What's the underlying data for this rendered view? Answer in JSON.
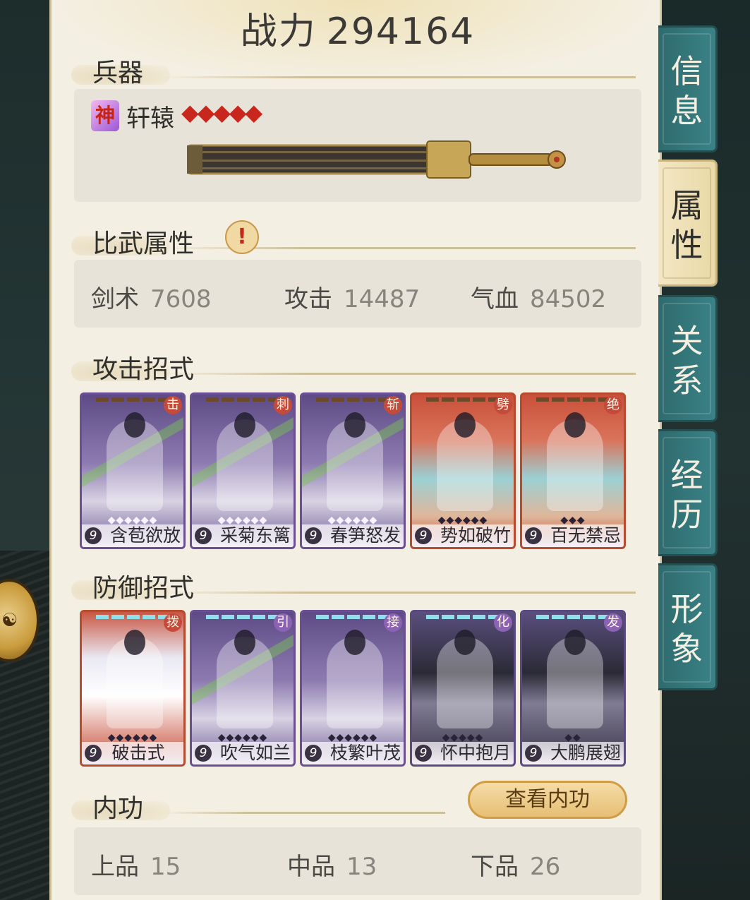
{
  "power": {
    "label": "战力",
    "value": "294164"
  },
  "sections": {
    "weapon": "兵器",
    "compare": "比武属性",
    "attack": "攻击招式",
    "defense": "防御招式",
    "inner": "内功"
  },
  "weapon": {
    "badge": "神",
    "name": "轩辕",
    "stars": "◆◆◆◆◆"
  },
  "compare_attrs": [
    {
      "label": "剑术",
      "value": "7608"
    },
    {
      "label": "攻击",
      "value": "14487"
    },
    {
      "label": "气血",
      "value": "84502"
    }
  ],
  "attack_moves": [
    {
      "tag": "击",
      "level": "9",
      "name": "含苞欲放",
      "stars": "◆◆◆◆◆◆"
    },
    {
      "tag": "刺",
      "level": "9",
      "name": "采菊东篱",
      "stars": "◆◆◆◆◆◆"
    },
    {
      "tag": "斩",
      "level": "9",
      "name": "春笋怒发",
      "stars": "◆◆◆◆◆◆"
    },
    {
      "tag": "劈",
      "level": "9",
      "name": "势如破竹",
      "stars": "◆◆◆◆◆◆"
    },
    {
      "tag": "绝",
      "level": "9",
      "name": "百无禁忌",
      "stars": "◆◆◆"
    }
  ],
  "defense_moves": [
    {
      "tag": "拨",
      "level": "9",
      "name": "破击式",
      "stars": "◆◆◆◆◆◆"
    },
    {
      "tag": "引",
      "level": "9",
      "name": "吹气如兰",
      "stars": "◆◆◆◆◆◆"
    },
    {
      "tag": "接",
      "level": "9",
      "name": "枝繁叶茂",
      "stars": "◆◆◆◆◆◆"
    },
    {
      "tag": "化",
      "level": "9",
      "name": "怀中抱月",
      "stars": "◆◆◆◆◆"
    },
    {
      "tag": "发",
      "level": "9",
      "name": "大鹏展翅",
      "stars": "◆◆"
    }
  ],
  "inner": {
    "button": "查看内功",
    "grades": [
      {
        "label": "上品",
        "value": "15"
      },
      {
        "label": "中品",
        "value": "13"
      },
      {
        "label": "下品",
        "value": "26"
      }
    ]
  },
  "tabs": [
    {
      "line1": "信",
      "line2": "息"
    },
    {
      "line1": "属",
      "line2": "性"
    },
    {
      "line1": "关",
      "line2": "系"
    },
    {
      "line1": "经",
      "line2": "历"
    },
    {
      "line1": "形",
      "line2": "象"
    }
  ],
  "active_tab": 1
}
